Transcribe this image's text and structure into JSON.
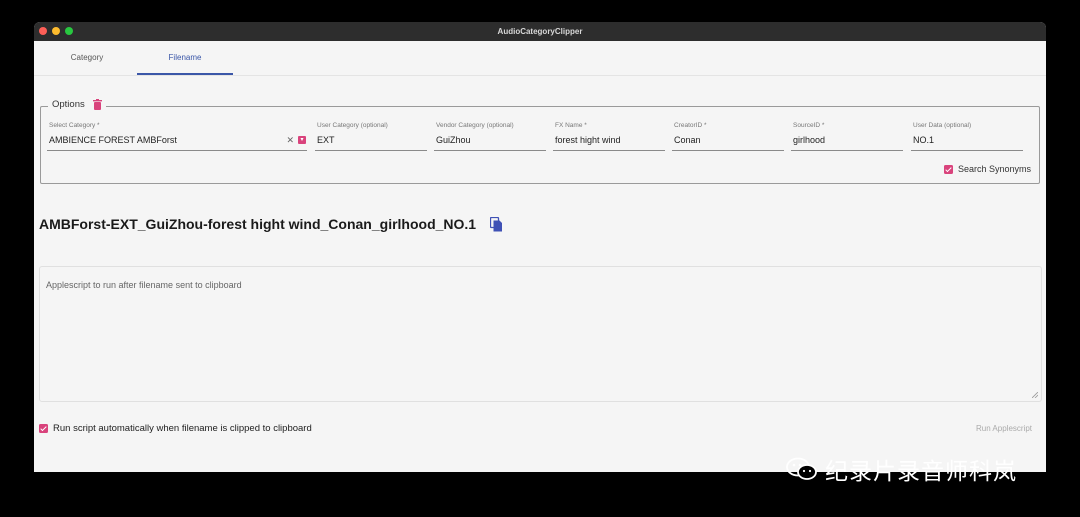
{
  "window": {
    "title": "AudioCategoryClipper"
  },
  "tabs": [
    {
      "label": "Category",
      "active": false
    },
    {
      "label": "Filename",
      "active": true
    }
  ],
  "options": {
    "legend": "Options",
    "fields": {
      "select_category": {
        "label": "Select Category *",
        "value": "AMBIENCE FOREST AMBForst"
      },
      "user_category": {
        "label": "User Category (optional)",
        "value": "EXT"
      },
      "vendor_category": {
        "label": "Vendor Category (optional)",
        "value": "GuiZhou"
      },
      "fx_name": {
        "label": "FX Name *",
        "value": "forest hight wind"
      },
      "creator_id": {
        "label": "CreatorID *",
        "value": "Conan"
      },
      "source_id": {
        "label": "SourceID *",
        "value": "girlhood"
      },
      "user_data": {
        "label": "User Data (optional)",
        "value": "NO.1"
      }
    },
    "search_synonyms": {
      "label": "Search Synonyms",
      "checked": true
    }
  },
  "filename": {
    "text": "AMBForst-EXT_GuiZhou-forest hight wind_Conan_girlhood_NO.1"
  },
  "script": {
    "placeholder": "Applescript to run after filename sent to clipboard"
  },
  "auto_run": {
    "label": "Run script automatically when filename is clipped to clipboard",
    "checked": true
  },
  "run_button": {
    "label": "Run Applescript"
  },
  "watermark": {
    "text": "纪录片录音师科岚"
  },
  "colors": {
    "accent": "#3b57a8",
    "checkbox": "#d9437c",
    "icon_blue": "#3f51b5"
  },
  "icons": {
    "trash": "trash-icon",
    "copy": "copy-icon",
    "clear": "close-icon",
    "dropdown": "dropdown-icon"
  }
}
